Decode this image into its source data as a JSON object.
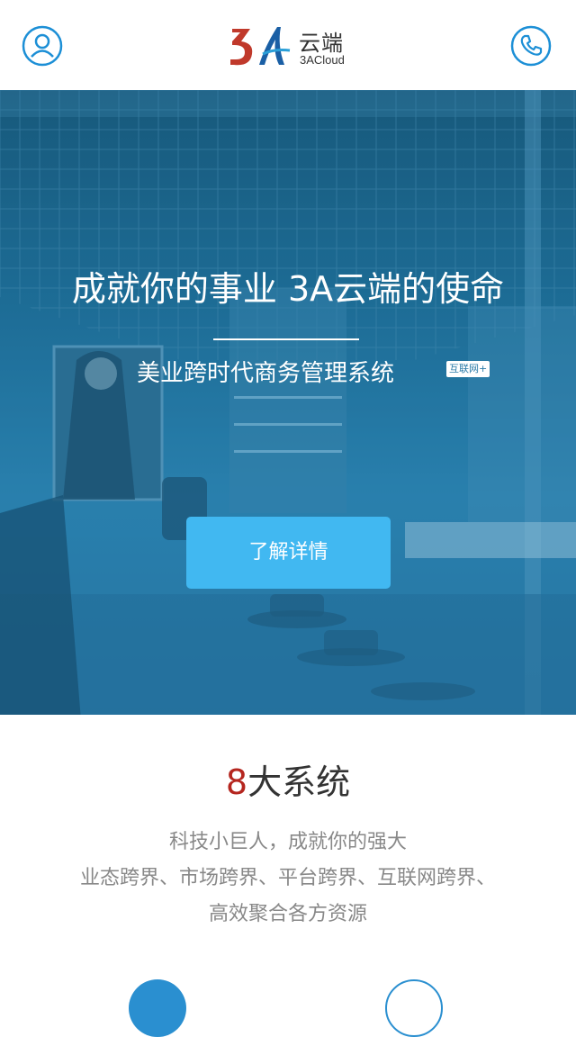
{
  "header": {
    "logo_cn": "云端",
    "logo_en": "3ACloud"
  },
  "icons": {
    "user": "user-icon",
    "phone": "phone-icon"
  },
  "colors": {
    "accent": "#1c8fd6",
    "logo_red": "#c0392b",
    "button": "#41b8f1",
    "highlight_number": "#b5261f"
  },
  "hero": {
    "title": "成就你的事业  3A云端的使命",
    "subtitle": "美业跨时代商务管理系统",
    "badge": "互联网+",
    "button_label": "了解详情"
  },
  "systems": {
    "title_number": "8",
    "title_text": "大系统",
    "desc_line1": "科技小巨人，成就你的强大",
    "desc_line2": "业态跨界、市场跨界、平台跨界、互联网跨界、",
    "desc_line3": "高效聚合各方资源"
  }
}
